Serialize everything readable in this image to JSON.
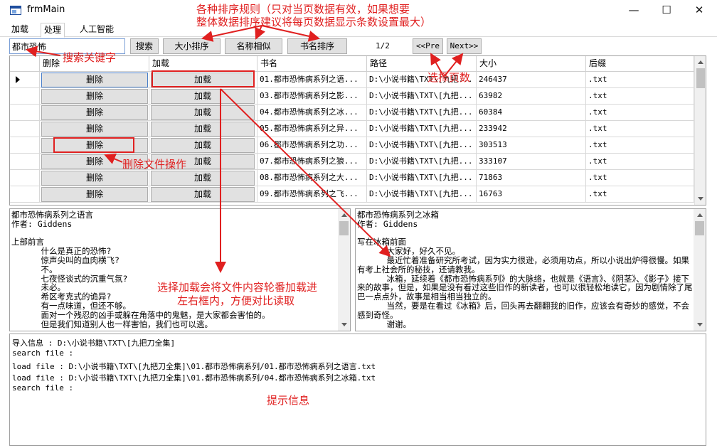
{
  "window": {
    "title": "frmMain",
    "minimize": "—",
    "maximize": "☐",
    "close": "✕"
  },
  "menu": {
    "tabs": [
      "加载",
      "处理",
      "人工智能"
    ]
  },
  "toolbar": {
    "search_value": "都市恐怖",
    "search_btn": "搜索",
    "size_sort": "大小排序",
    "name_similar": "名称相似",
    "title_sort": "书名排序",
    "page": "1/2",
    "prev": "<<Pre",
    "next": "Next>>"
  },
  "grid": {
    "columns": [
      "删除",
      "加载",
      "书名",
      "路径",
      "大小",
      "后缀"
    ],
    "rows": [
      {
        "del": "删除",
        "load": "加载",
        "name": "01.都市恐怖病系列之语...",
        "path": "D:\\小说书籍\\TXT\\[九把...",
        "size": "246437",
        "ext": ".txt"
      },
      {
        "del": "删除",
        "load": "加载",
        "name": "03.都市恐怖病系列之影...",
        "path": "D:\\小说书籍\\TXT\\[九把...",
        "size": "63982",
        "ext": ".txt"
      },
      {
        "del": "删除",
        "load": "加载",
        "name": "04.都市恐怖病系列之冰...",
        "path": "D:\\小说书籍\\TXT\\[九把...",
        "size": "60384",
        "ext": ".txt"
      },
      {
        "del": "删除",
        "load": "加载",
        "name": "05.都市恐怖病系列之异...",
        "path": "D:\\小说书籍\\TXT\\[九把...",
        "size": "233942",
        "ext": ".txt"
      },
      {
        "del": "删除",
        "load": "加载",
        "name": "06.都市恐怖病系列之功...",
        "path": "D:\\小说书籍\\TXT\\[九把...",
        "size": "303513",
        "ext": ".txt"
      },
      {
        "del": "删除",
        "load": "加载",
        "name": "07.都市恐怖病系列之狼...",
        "path": "D:\\小说书籍\\TXT\\[九把...",
        "size": "333107",
        "ext": ".txt"
      },
      {
        "del": "删除",
        "load": "加载",
        "name": "08.都市恐怖病系列之大...",
        "path": "D:\\小说书籍\\TXT\\[九把...",
        "size": "71863",
        "ext": ".txt"
      },
      {
        "del": "删除",
        "load": "加载",
        "name": "09.都市恐怖病系列之飞...",
        "path": "D:\\小说书籍\\TXT\\[九把...",
        "size": "16763",
        "ext": ".txt"
      }
    ]
  },
  "left_pane": {
    "text": "都市恐怖病系列之语言\n作者: Giddens\n\n上部前言\n      什么是真正的恐怖?\n      惊声尖叫的血肉横飞?\n      不。\n      七夜怪谈式的沉重气氛?\n      未必。\n      希区考克式的诡异?\n      有一点味道，但还不够。\n      面对一个残忍的凶手或躲在角落中的鬼魅，是大家都会害怕的。\n      但是我们知道别人也一样害怕，我们也可以逃。"
  },
  "right_pane": {
    "text": "都市恐怖病系列之冰箱\n作者: Giddens\n\n写在冰箱前面\n      大家好，好久不见。\n      最近忙着准备研究所考试，因为实力很逊，必须用功点，所以小说出炉得很慢。如果有考上社会所的秘技，还请教我。\n      冰箱，延续着《都市恐怖病系列》的大脉络，也就是《语言》、《阴茎》、《影子》接下来的故事，但是，如果是没有看过这些旧作的新读者，也可以很轻松地读它，因为剧情除了尾巴一点点外，故事是相当相当独立的。\n      当然，要是在看过《冰箱》后，回头再去翻翻我的旧作，应该会有奇妙的感觉，不会感到奇怪。\n      谢谢。"
  },
  "log": {
    "lines": [
      "导入信息 : D:\\小说书籍\\TXT\\[九把刀全集]",
      "search file :",
      "load file : D:\\小说书籍\\TXT\\[九把刀全集]\\01.都市恐怖病系列/01.都市恐怖病系列之语言.txt",
      "load file : D:\\小说书籍\\TXT\\[九把刀全集]\\01.都市恐怖病系列/04.都市恐怖病系列之冰箱.txt",
      "search file :"
    ]
  },
  "annotations": {
    "sort_rules_1": "各种排序规则（只对当页数据有效，如果想要",
    "sort_rules_2": "整体数据排序建议将每页数据显示条数设置最大）",
    "search_key": "搜索关键字",
    "page_select": "选择页数",
    "delete_op": "删除文件操作",
    "load_desc_1": "选择加载会将文件内容轮番加载进",
    "load_desc_2": "左右框内，方便对比读取",
    "hint": "提示信息"
  },
  "colors": {
    "annotation": "#e02020",
    "button": "#e1e1e1",
    "border": "#a0a0a0"
  }
}
